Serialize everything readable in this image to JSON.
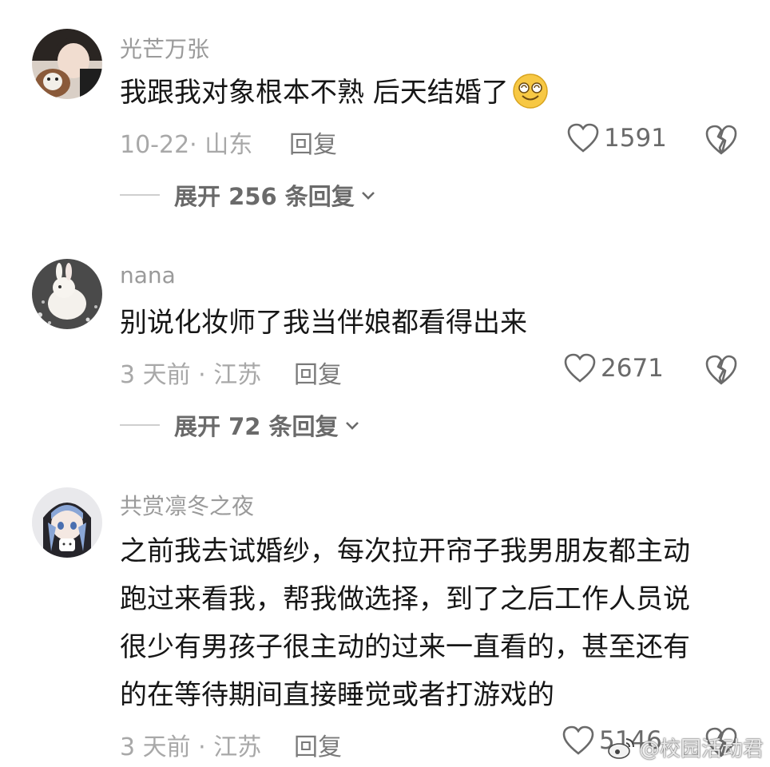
{
  "comments": [
    {
      "username": "光芒万张",
      "text": "我跟我对象根本不熟 后天结婚了",
      "emoji": "dizzy-smile-emoji",
      "date": "10-22· 山东",
      "reply_label": "回复",
      "likes": "1591",
      "expand_label": "展开 256 条回复"
    },
    {
      "username": "nana",
      "text": "别说化妆师了我当伴娘都看得出来",
      "date": "3 天前 · 江苏",
      "reply_label": "回复",
      "likes": "2671",
      "expand_label": "展开 72 条回复"
    },
    {
      "username": "共赏凛冬之夜",
      "lines": [
        "之前我去试婚纱，每次拉开帘子我男朋友都主动",
        "跑过来看我，帮我做选择，到了之后工作人员说",
        "很少有男孩子很主动的过来一直看的，甚至还有",
        "的在等待期间直接睡觉或者打游戏的"
      ],
      "date": "3 天前 · 江苏",
      "reply_label": "回复",
      "likes": "5146"
    }
  ],
  "watermark": "@校园活动君",
  "colors": {
    "username": "#9a9a9a",
    "meta": "#a8a8a8",
    "text": "#161616"
  }
}
